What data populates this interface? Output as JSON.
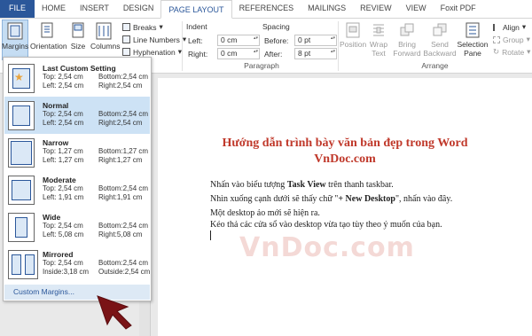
{
  "tabs": [
    {
      "label": "FILE"
    },
    {
      "label": "HOME"
    },
    {
      "label": "INSERT"
    },
    {
      "label": "DESIGN"
    },
    {
      "label": "PAGE LAYOUT"
    },
    {
      "label": "REFERENCES"
    },
    {
      "label": "MAILINGS"
    },
    {
      "label": "REVIEW"
    },
    {
      "label": "VIEW"
    },
    {
      "label": "Foxit PDF"
    }
  ],
  "ribbon": {
    "margins": "Margins",
    "orientation": "Orientation",
    "size": "Size",
    "columns": "Columns",
    "breaks": "Breaks",
    "line_numbers": "Line Numbers",
    "hyphenation": "Hyphenation",
    "indent_header": "Indent",
    "spacing_header": "Spacing",
    "left_label": "Left:",
    "right_label": "Right:",
    "before_label": "Before:",
    "after_label": "After:",
    "left_value": "0 cm",
    "right_value": "0 cm",
    "before_value": "0 pt",
    "after_value": "8 pt",
    "paragraph_group": "Paragraph",
    "position": "Position",
    "wrap_text": "Wrap Text",
    "bring_forward": "Bring Forward",
    "send_backward": "Send Backward",
    "selection_pane": "Selection Pane",
    "align": "Align",
    "group": "Group",
    "rotate": "Rotate",
    "arrange_group": "Arrange"
  },
  "margins_menu": {
    "options": [
      {
        "name": "Last Custom Setting",
        "top": "Top:  2,54 cm",
        "bottom": "Bottom:2,54 cm",
        "left": "Left:  2,54 cm",
        "right": "Right:2,54 cm"
      },
      {
        "name": "Normal",
        "top": "Top:  2,54 cm",
        "bottom": "Bottom:2,54 cm",
        "left": "Left:  2,54 cm",
        "right": "Right:2,54 cm"
      },
      {
        "name": "Narrow",
        "top": "Top:  1,27 cm",
        "bottom": "Bottom:1,27 cm",
        "left": "Left:  1,27 cm",
        "right": "Right:1,27 cm"
      },
      {
        "name": "Moderate",
        "top": "Top:  2,54 cm",
        "bottom": "Bottom:2,54 cm",
        "left": "Left:  1,91 cm",
        "right": "Right:1,91 cm"
      },
      {
        "name": "Wide",
        "top": "Top:  2,54 cm",
        "bottom": "Bottom:2,54 cm",
        "left": "Left:  5,08 cm",
        "right": "Right:5,08 cm"
      },
      {
        "name": "Mirrored",
        "top": "Top:  2,54 cm",
        "bottom": "Bottom:2,54 cm",
        "left": "Inside:3,18 cm",
        "right": "Outside:2,54 cm"
      }
    ],
    "custom": "Custom Margins..."
  },
  "document": {
    "title_line1": "Hướng dẫn trình bày văn bản đẹp trong Word",
    "title_line2": "VnDoc.com",
    "p1_a": "Nhấn vào biểu tượng ",
    "p1_b": "Task View",
    "p1_c": " trên thanh taskbar.",
    "p2_a": "Nhìn xuống cạnh dưới sẽ thấy chữ \"",
    "p2_b": "+ New Desktop",
    "p2_c": "\", nhấn vào đây.",
    "p3": "Một desktop ảo mới sẽ hiện ra.",
    "p4": "Kéo thả các cửa sổ vào desktop vừa tạo tùy theo ý muốn của bạn."
  },
  "watermark": "VnDoc.com",
  "colors": {
    "accent": "#2b579a",
    "title_red": "#c0392b",
    "selected": "#cde2f5"
  }
}
